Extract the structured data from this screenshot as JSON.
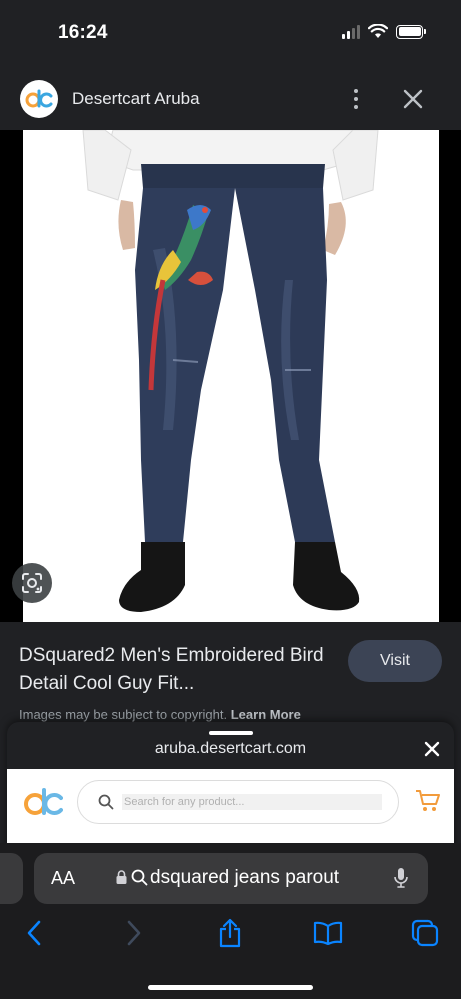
{
  "status_bar": {
    "time": "16:24"
  },
  "header": {
    "site_name": "Desertcart Aruba"
  },
  "product": {
    "title": "DSquared2 Men's Embroidered Bird Detail Cool Guy Fit...",
    "visit_label": "Visit",
    "copyright_text": "Images may be subject to copyright.",
    "learn_more_label": "Learn More"
  },
  "preview": {
    "domain": "aruba.desertcart.com",
    "search_placeholder": "Search for any product..."
  },
  "browser": {
    "aa_label": "AA",
    "url_text": "dsquared jeans parout"
  },
  "colors": {
    "background": "#202124",
    "visit_button": "#3c4455",
    "accent_blue": "#0a84ff"
  }
}
